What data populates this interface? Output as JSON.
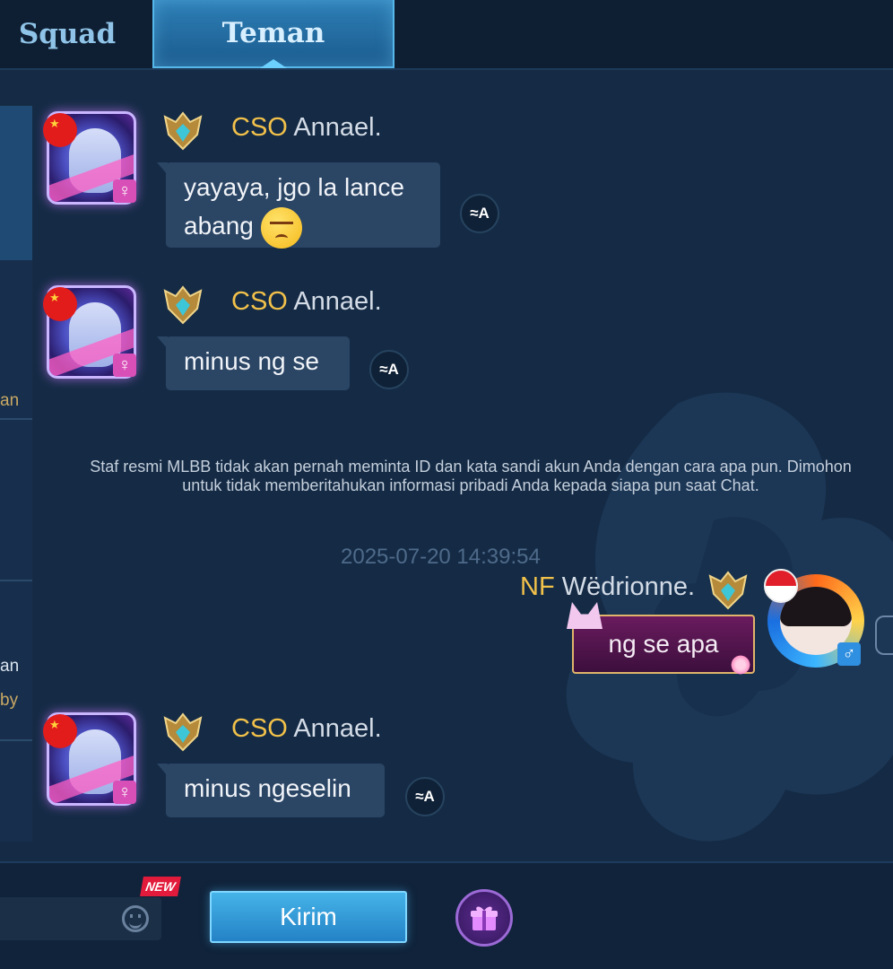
{
  "tabs": [
    {
      "label": "Squad",
      "active": false
    },
    {
      "label": "Teman",
      "active": true
    }
  ],
  "left_strip": {
    "fragments": [
      "an",
      "an",
      "by"
    ]
  },
  "messages": [
    {
      "sender_tag": "CSO",
      "sender_name": "Annael.",
      "text_line1": "yayaya, jgo la lance",
      "text_line2": "abang",
      "emoji": "squint-face-emoji",
      "gender": "♀"
    },
    {
      "sender_tag": "CSO",
      "sender_name": "Annael.",
      "text": "minus ng se",
      "gender": "♀"
    },
    {
      "sender_tag": "CSO",
      "sender_name": "Annael.",
      "text": "minus ngeselin",
      "gender": "♀"
    }
  ],
  "translate_label": "≈A",
  "system_notice": "Staf resmi MLBB tidak akan pernah meminta ID dan kata sandi akun Anda dengan cara apa pun. Dimohon untuk tidak memberitahukan informasi pribadi Anda kepada siapa pun saat Chat.",
  "timestamp": "2025-07-20 14:39:54",
  "own_message": {
    "sender_tag": "NF",
    "sender_name": "Wëdrionne.",
    "text": "ng se apa",
    "gender": "♂"
  },
  "input_bar": {
    "new_badge": "NEW",
    "send_label": "Kirim"
  },
  "colors": {
    "background": "#152b45",
    "tag_gold": "#f2c14a",
    "bubble": "#2b4565",
    "accent_blue": "#2f95d6"
  }
}
